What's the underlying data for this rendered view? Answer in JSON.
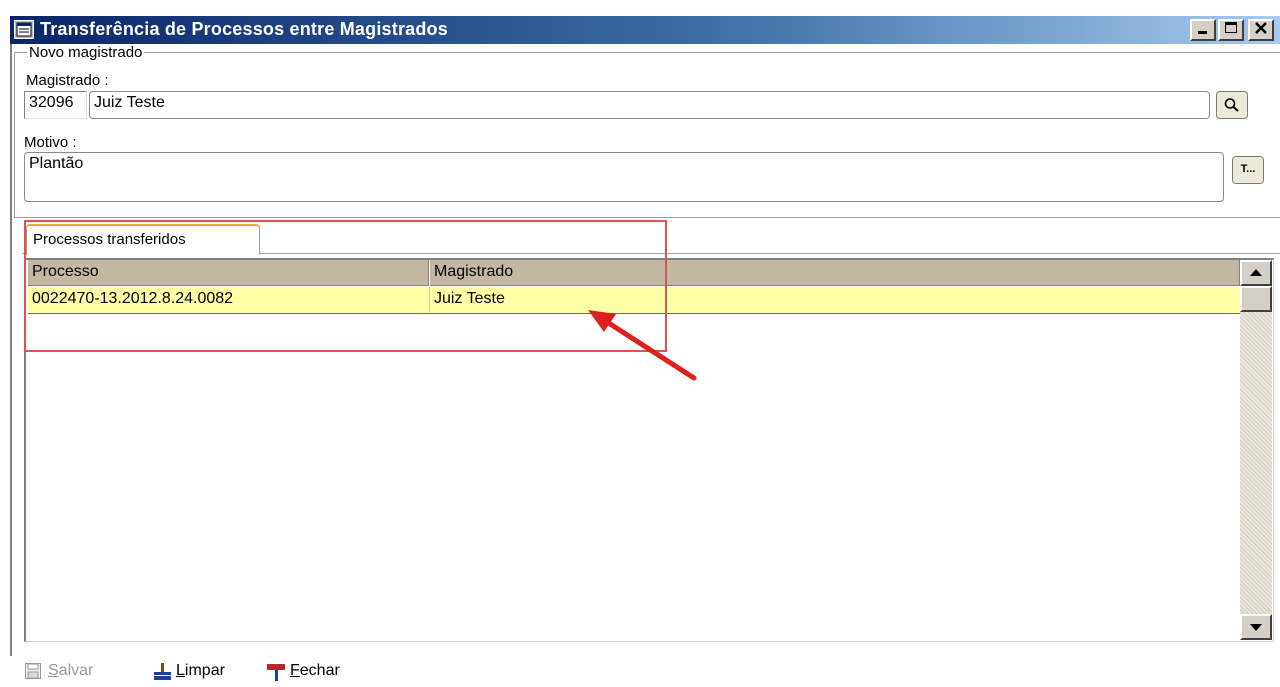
{
  "window": {
    "title": "Transferência de Processos entre Magistrados",
    "controls": [
      "minimize",
      "maximize",
      "close"
    ]
  },
  "novo_magistrado": {
    "legend": "Novo magistrado",
    "magistrado_label": "Magistrado :",
    "magistrado_code": "32096",
    "magistrado_name": "Juiz Teste",
    "search_icon": "magnifier-icon",
    "motivo_label": "Motivo :",
    "motivo_value": "Plantão",
    "text_editor_button": "T..."
  },
  "tabs": [
    {
      "label": "Processos transferidos",
      "active": true
    }
  ],
  "grid": {
    "columns": [
      "Processo",
      "Magistrado"
    ],
    "rows": [
      {
        "processo": "0022470-13.2012.8.24.0082",
        "magistrado": "Juiz Teste"
      }
    ],
    "selected_row_color": "#ffffa6",
    "header_color": "#c3b9a3"
  },
  "toolbar": {
    "save_label": "Salvar",
    "save_enabled": false,
    "clear_label": "Limpar",
    "close_label": "Fechar"
  },
  "annotation": {
    "color": "#e05252"
  }
}
